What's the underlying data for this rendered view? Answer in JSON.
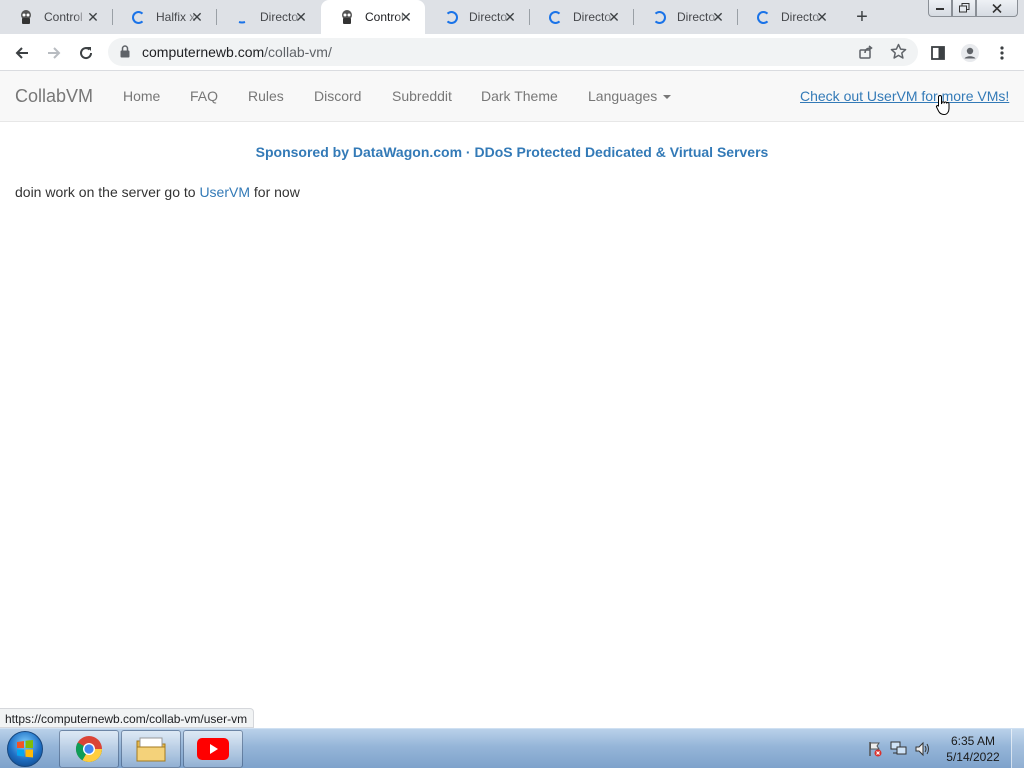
{
  "browser": {
    "tabs": [
      {
        "title": "Control",
        "icon": "collabvm-icon",
        "active": false
      },
      {
        "title": "Halfix x",
        "icon": "loading-spinner-icon",
        "active": false
      },
      {
        "title": "Directo",
        "icon": "loading-dot-icon",
        "active": false
      },
      {
        "title": "Control",
        "icon": "collabvm-icon",
        "active": true
      },
      {
        "title": "Directo",
        "icon": "loading-spinner-icon",
        "active": false
      },
      {
        "title": "Directo",
        "icon": "loading-spinner-icon",
        "active": false
      },
      {
        "title": "Directo",
        "icon": "loading-spinner-icon",
        "active": false
      },
      {
        "title": "Directo",
        "icon": "loading-spinner-icon",
        "active": false
      }
    ],
    "close_glyph": "✕",
    "new_tab_glyph": "+",
    "url_host": "computernewb.com",
    "url_path": "/collab-vm/",
    "status_url": "https://computernewb.com/collab-vm/user-vm"
  },
  "site": {
    "brand": "CollabVM",
    "nav": {
      "home": "Home",
      "faq": "FAQ",
      "rules": "Rules",
      "discord": "Discord",
      "subreddit": "Subreddit",
      "dark_theme": "Dark Theme",
      "languages": "Languages"
    },
    "promo_link": "Check out UserVM for more VMs!",
    "sponsor": "Sponsored by DataWagon.com · DDoS Protected Dedicated & Virtual Servers",
    "notice": {
      "before": "doin work on the server go to ",
      "link": "UserVM",
      "after": " for now"
    }
  },
  "taskbar": {
    "time": "6:35 AM",
    "date": "5/14/2022",
    "pinned": [
      "chrome-icon",
      "file-explorer-icon",
      "youtube-icon"
    ]
  },
  "colors": {
    "link": "#337ab7",
    "navbar_bg": "#f8f8f8",
    "tab_strip": "#dee1e6",
    "spinner": "#1a73e8"
  }
}
